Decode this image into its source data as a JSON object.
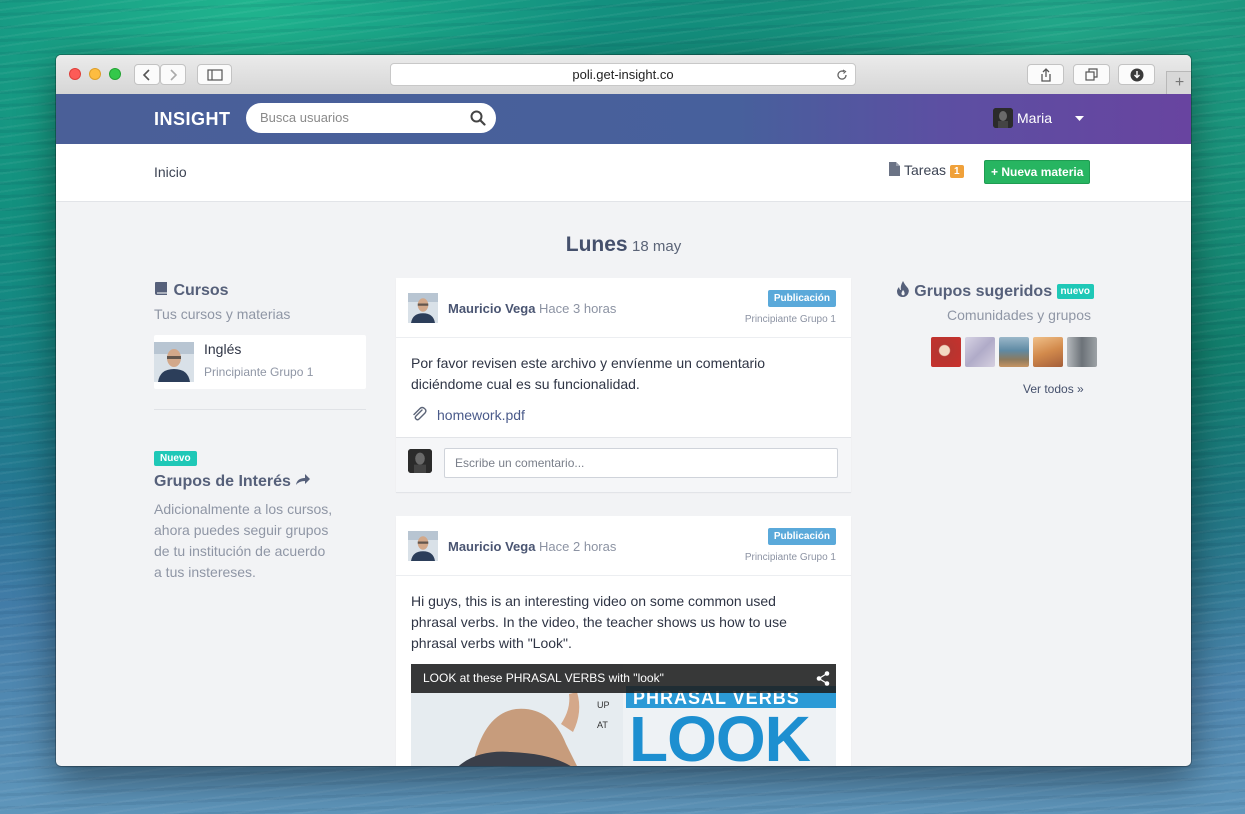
{
  "browser": {
    "url": "poli.get-insight.co",
    "new_tab_label": "+"
  },
  "header": {
    "logo": "INSIGHT",
    "search_placeholder": "Busca usuarios",
    "user_name": "Maria"
  },
  "subnav": {
    "home": "Inicio",
    "tasks_label": "Tareas",
    "tasks_count": "1",
    "new_subject_button": "+ Nueva materia"
  },
  "date": {
    "day": "Lunes",
    "rest": "18 may"
  },
  "courses": {
    "title": "Cursos",
    "subtitle": "Tus cursos y materias",
    "items": [
      {
        "name": "Inglés",
        "group": "Principiante Grupo 1"
      }
    ]
  },
  "interest_groups": {
    "badge": "Nuevo",
    "title": "Grupos de Interés",
    "description_lines": [
      "Adicionalmente a los cursos,",
      "ahora puedes seguir grupos",
      "de tu institución de acuerdo",
      "a tus instereses."
    ]
  },
  "posts": [
    {
      "author": "Mauricio Vega",
      "time": "Hace 3 horas",
      "tag": "Publicación",
      "group": "Principiante Grupo 1",
      "body_lines": [
        "Por favor revisen este archivo y envíenme un comentario",
        "diciéndome cual es su funcionalidad."
      ],
      "attachment": "homework.pdf",
      "comment_placeholder": "Escribe un comentario..."
    },
    {
      "author": "Mauricio Vega",
      "time": "Hace 2 horas",
      "tag": "Publicación",
      "group": "Principiante Grupo 1",
      "body_lines": [
        "Hi guys, this is an interesting video on some common used",
        "phrasal verbs. In the video, the teacher shows us how to use",
        "phrasal verbs with \"Look\"."
      ],
      "video_title": "LOOK at these PHRASAL VERBS with \"look\"",
      "video_banner": "PHRASAL VERBS",
      "video_big_word": "LOOK",
      "whiteboard_words": [
        "UP",
        "AT"
      ]
    }
  ],
  "suggested_groups": {
    "title": "Grupos sugeridos",
    "badge": "nuevo",
    "subtitle": "Comunidades y grupos",
    "see_all": "Ver todos »",
    "thumb_colors": [
      "#c9302c",
      "#b9b6cf",
      "#5f8aa4",
      "#d28a4c",
      "#6c7278"
    ]
  },
  "colors": {
    "header_start": "#4a5f98",
    "header_end": "#6844a0",
    "green": "#27b561",
    "teal": "#1fc8b7",
    "blue_tag": "#5aa9da",
    "orange": "#f0a13a"
  }
}
